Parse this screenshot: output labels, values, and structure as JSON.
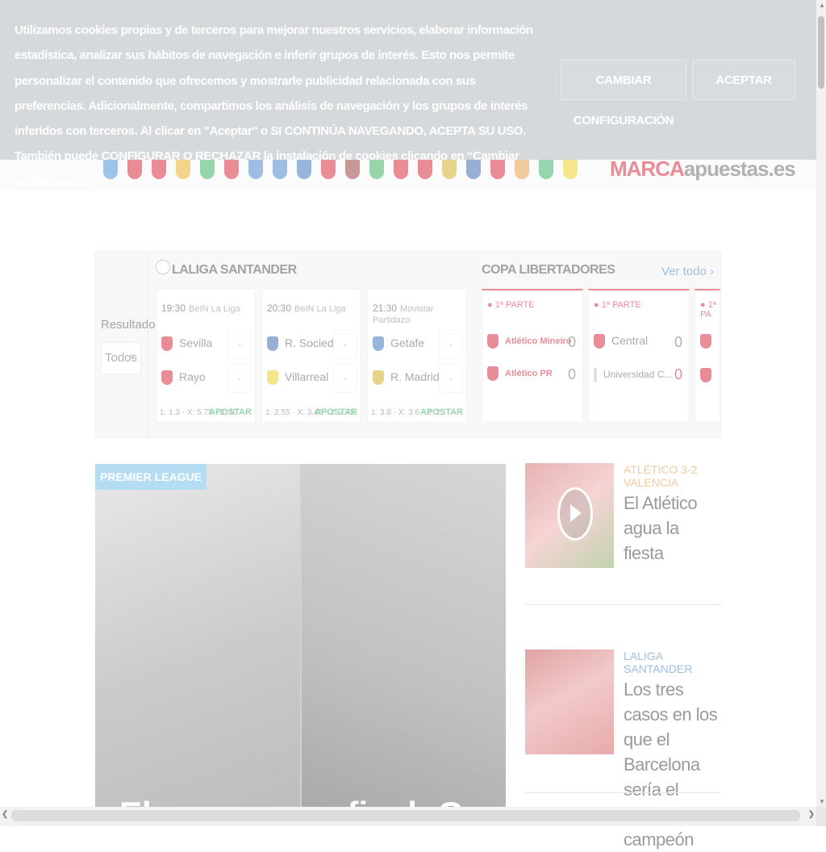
{
  "cookie_banner": {
    "text": "Utilizamos cookies propias y de terceros para mejorar nuestros servicios, elaborar información estadística, analizar sus hábitos de navegación e inferir grupos de interés. Esto nos permite personalizar el contenido que ofrecemos y mostrarle publicidad relacionada con sus preferencias. Adicionalmente, compartimos los análisis de navegación y los grupos de interés inferidos con terceros. Al clicar en \"Aceptar\" o SI CONTINÚA NAVEGANDO, ACEPTA SU USO. También puede CONFIGURAR O RECHAZAR la instalación de cookies clicando en “Cambiar configuración”.",
    "config_button": "CAMBIAR CONFIGURACIÓN",
    "accept_button": "ACEPTAR"
  },
  "header": {
    "brand_part1": "MARCA",
    "brand_part2": "apuestas.es",
    "crest_colors": [
      "#2a7bd0",
      "#d0021b",
      "#d0021b",
      "#e8a000",
      "#1aa64a",
      "#d0021b",
      "#2b6fc4",
      "#2b6fc4",
      "#1a5fb4",
      "#d0021b",
      "#8b1a1a",
      "#1aa64a",
      "#d0021b",
      "#d0021b",
      "#c9a100",
      "#1a4fa0",
      "#d0021b",
      "#e58a2a",
      "#1aa64a",
      "#e8c800"
    ]
  },
  "scores": {
    "results_label": "Resultados:",
    "filter_value": "Todos",
    "laliga": {
      "title": "LALIGA SANTANDER",
      "matches": [
        {
          "time": "19:30",
          "tv": "BeIN La Liga",
          "home": "Sevilla",
          "away": "Rayo",
          "home_score": "-",
          "away_score": "-",
          "odds": "1: 1.3 · X: 5.75 · 2: 10",
          "bet": "APOSTAR",
          "home_color": "#d0021b",
          "away_color": "#d0021b"
        },
        {
          "time": "20:30",
          "tv": "BeIN La Liga",
          "home": "R. Sociedad",
          "away": "Villarreal",
          "home_score": "-",
          "away_score": "-",
          "odds": "1: 2.55 · X: 3.45 · 2: 2.75",
          "bet": "APOSTAR",
          "home_color": "#1a4fa0",
          "away_color": "#e8c800"
        },
        {
          "time": "21:30",
          "tv": "Movistar Partidazo",
          "home": "Getafe",
          "away": "R. Madrid",
          "home_score": "-",
          "away_score": "-",
          "odds": "1: 3.8 · X: 3.6 · 2: 2",
          "bet": "APOSTAR",
          "home_color": "#1a5fb4",
          "away_color": "#c9a100"
        }
      ]
    },
    "libertadores": {
      "title": "COPA LIBERTADORES",
      "see_all": "Ver todo ›",
      "matches": [
        {
          "period": "● 1ª PARTE",
          "home": "Atlético Mineiro",
          "away": "Atlético PR",
          "home_score": "0",
          "away_score": "0"
        },
        {
          "period": "● 1ª PARTE",
          "home": "Central",
          "away": "Universidad C...",
          "home_score": "0",
          "away_score": "0"
        },
        {
          "period": "● 1ª PA",
          "home": "",
          "away": "",
          "home_score": "",
          "away_score": ""
        }
      ]
    }
  },
  "hero": {
    "tag": "PREMIER LEAGUE",
    "title": "El cara a cara final: Guardiola o Klopp"
  },
  "side_articles": [
    {
      "kicker": "ATLÉTICO 3-2 VALENCIA",
      "title": "El Atlético agua la fiesta",
      "video": true
    },
    {
      "kicker": "LALIGA SANTANDER",
      "title": "Los tres casos en los que el Barcelona sería el sábado campeón",
      "video": false
    }
  ]
}
